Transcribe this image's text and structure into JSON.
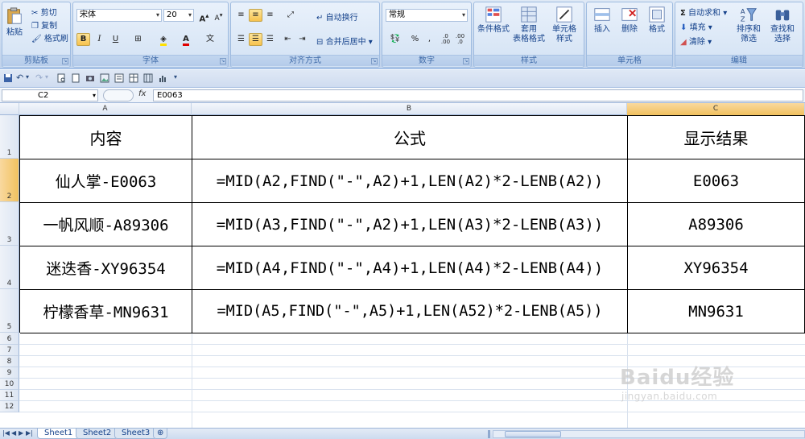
{
  "ribbon": {
    "clipboard": {
      "label": "剪贴板",
      "paste": "粘贴",
      "cut": "剪切",
      "copy": "复制",
      "format_painter": "格式刷"
    },
    "font": {
      "label": "字体",
      "name": "宋体",
      "size": "20",
      "grow": "A",
      "shrink": "A",
      "bold": "B",
      "italic": "I",
      "underline": "U",
      "phonetic": "文"
    },
    "alignment": {
      "label": "对齐方式",
      "wrap": "自动换行",
      "merge": "合并后居中"
    },
    "number": {
      "label": "数字",
      "format": "常规",
      "percent": "%",
      "comma": ",",
      "inc_decimal": ".0 .00",
      "dec_decimal": ".00 .0"
    },
    "styles": {
      "label": "样式",
      "conditional": "条件格式",
      "table_format_1": "套用",
      "table_format_2": "表格格式",
      "cell_styles_1": "单元格",
      "cell_styles_2": "样式"
    },
    "cells": {
      "label": "单元格",
      "insert": "插入",
      "delete": "删除",
      "format": "格式"
    },
    "editing": {
      "label": "编辑",
      "autosum": "自动求和",
      "fill": "填充",
      "clear": "清除",
      "sort_1": "排序和",
      "sort_2": "筛选",
      "find_1": "查找和",
      "find_2": "选择"
    }
  },
  "formula_bar": {
    "name_box": "C2",
    "fx": "fx",
    "formula": "E0063"
  },
  "columns": [
    "A",
    "B",
    "C"
  ],
  "row_numbers": [
    "1",
    "2",
    "3",
    "4",
    "5",
    "6",
    "7",
    "8",
    "9",
    "10",
    "11",
    "12"
  ],
  "table": {
    "headers": [
      "内容",
      "公式",
      "显示结果"
    ],
    "rows": [
      [
        "仙人掌-E0063",
        "=MID(A2,FIND(\"-\",A2)+1,LEN(A2)*2-LENB(A2))",
        "E0063"
      ],
      [
        "一帆风顺-A89306",
        "=MID(A3,FIND(\"-\",A2)+1,LEN(A3)*2-LENB(A3))",
        "A89306"
      ],
      [
        "迷迭香-XY96354",
        "=MID(A4,FIND(\"-\",A4)+1,LEN(A4)*2-LENB(A4))",
        "XY96354"
      ],
      [
        "柠檬香草-MN9631",
        "=MID(A5,FIND(\"-\",A5)+1,LEN(A52)*2-LENB(A5))",
        "MN9631"
      ]
    ]
  },
  "sheets": [
    "Sheet1",
    "Sheet2",
    "Sheet3"
  ],
  "watermark": {
    "brand": "Baidu经验",
    "url": "jingyan.baidu.com"
  }
}
